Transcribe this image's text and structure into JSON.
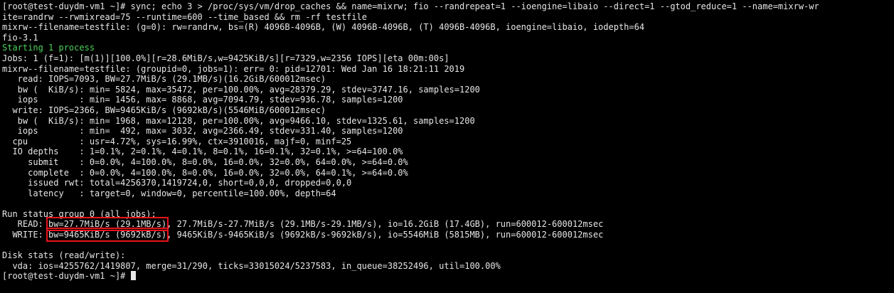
{
  "terminal": {
    "lines": [
      "[root@test-duydm-vm1 ~]# sync; echo 3 > /proc/sys/vm/drop_caches && name=mixrw; fio --randrepeat=1 --ioengine=libaio --direct=1 --gtod_reduce=1 --name=mixrw-wr",
      "ite=randrw --rwmixread=75 --runtime=600 --time_based && rm -rf testfile",
      "mixrw--filename=testfile: (g=0): rw=randrw, bs=(R) 4096B-4096B, (W) 4096B-4096B, (T) 4096B-4096B, ioengine=libaio, iodepth=64",
      "fio-3.1",
      "Starting 1 process",
      "Jobs: 1 (f=1): [m(1)][100.0%][r=28.6MiB/s,w=9425KiB/s][r=7329,w=2356 IOPS][eta 00m:00s]",
      "mixrw--filename=testfile: (groupid=0, jobs=1): err= 0: pid=12701: Wed Jan 16 18:21:11 2019",
      "   read: IOPS=7093, BW=27.7MiB/s (29.1MB/s)(16.2GiB/600012msec)",
      "   bw (  KiB/s): min= 5824, max=35472, per=100.00%, avg=28379.29, stdev=3747.16, samples=1200",
      "   iops        : min= 1456, max= 8868, avg=7094.79, stdev=936.78, samples=1200",
      "  write: IOPS=2366, BW=9465KiB/s (9692kB/s)(5546MiB/600012msec)",
      "   bw (  KiB/s): min= 1968, max=12128, per=100.00%, avg=9466.10, stdev=1325.61, samples=1200",
      "   iops        : min=  492, max= 3032, avg=2366.49, stdev=331.40, samples=1200",
      "  cpu          : usr=4.72%, sys=16.99%, ctx=3910016, majf=0, minf=25",
      "  IO depths    : 1=0.1%, 2=0.1%, 4=0.1%, 8=0.1%, 16=0.1%, 32=0.1%, >=64=100.0%",
      "     submit    : 0=0.0%, 4=100.0%, 8=0.0%, 16=0.0%, 32=0.0%, 64=0.0%, >=64=0.0%",
      "     complete  : 0=0.0%, 4=100.0%, 8=0.0%, 16=0.0%, 32=0.0%, 64=0.1%, >=64=0.0%",
      "     issued rwt: total=4256370,1419724,0, short=0,0,0, dropped=0,0,0",
      "     latency   : target=0, window=0, percentile=100.00%, depth=64",
      "",
      "Run status group 0 (all jobs):"
    ],
    "starting_line_index": 4,
    "run_status": {
      "read": {
        "prefix": "   READ: ",
        "bw": "bw=27.7MiB/s (29.1MB/s)",
        "rest": ", 27.7MiB/s-27.7MiB/s (29.1MB/s-29.1MB/s), io=16.2GiB (17.4GB), run=600012-600012msec"
      },
      "write": {
        "prefix": "  WRITE: ",
        "bw": "bw=9465KiB/s (9692kB/s)",
        "rest": ", 9465KiB/s-9465KiB/s (9692kB/s-9692kB/s), io=5546MiB (5815MB), run=600012-600012msec"
      }
    },
    "disk_stats": [
      "",
      "Disk stats (read/write):",
      "  vda: ios=4255762/1419807, merge=31/290, ticks=33015024/5237583, in_queue=38252496, util=100.00%"
    ],
    "prompt": "[root@test-duydm-vm1 ~]# "
  },
  "colors": {
    "background": "#000000",
    "text": "#e6e6e6",
    "green": "#4cd35a",
    "highlight_box": "#e8131b"
  }
}
